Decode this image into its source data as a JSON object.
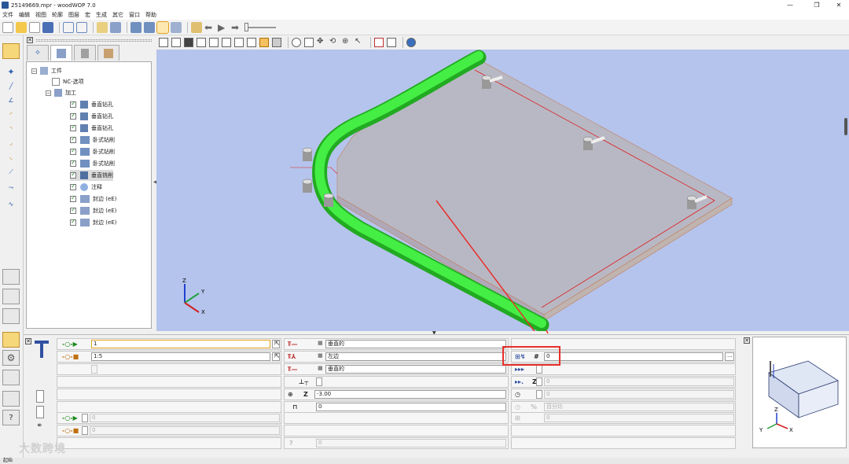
{
  "window": {
    "title": "25149669.mpr - woodWOP 7.0"
  },
  "menu": [
    "文件",
    "编辑",
    "视图",
    "轮廓",
    "图层",
    "宏",
    "生成",
    "其它",
    "窗口",
    "帮助"
  ],
  "tree": {
    "root": "工件",
    "nc": "NC-选项",
    "machining": "加工",
    "items": [
      "垂直钻孔",
      "垂直钻孔",
      "垂直钻孔",
      "卧式钻削",
      "卧式钻削",
      "卧式钻削",
      "垂直铣削",
      "注释",
      "封边 (eE)",
      "封边 (eE)",
      "封边 (eE)"
    ]
  },
  "axes": {
    "z": "Z",
    "y": "Y",
    "x": "X"
  },
  "params": {
    "col1": {
      "field1": "1",
      "field2": "1:5"
    },
    "col2": {
      "dir1": "垂直的",
      "side": "左边",
      "dir2": "垂直的",
      "z_label": "Z",
      "z_value": "-3.00",
      "offset_value": "0"
    },
    "col3": {
      "hash_label": "#",
      "hash_value": "0",
      "z_label": "Z",
      "percent_label": "%",
      "percent_text": "百分比",
      "zero_a": "0",
      "zero_b": "0",
      "zero_c": "0"
    },
    "bottom": {
      "left_zero1": "0",
      "left_zero2": "0",
      "bottom_zero": "0",
      "ellipsis": "..."
    }
  },
  "preview_axes": {
    "z": "Z",
    "y": "Y",
    "x": "X"
  },
  "status": {
    "text": "起始"
  },
  "watermark": "大数跨境",
  "colors": {
    "viewport_bg": "#b5c4ec",
    "edge_band": "#33dd33",
    "highlight": "#e8302a",
    "panel": "#b8b8c4"
  }
}
